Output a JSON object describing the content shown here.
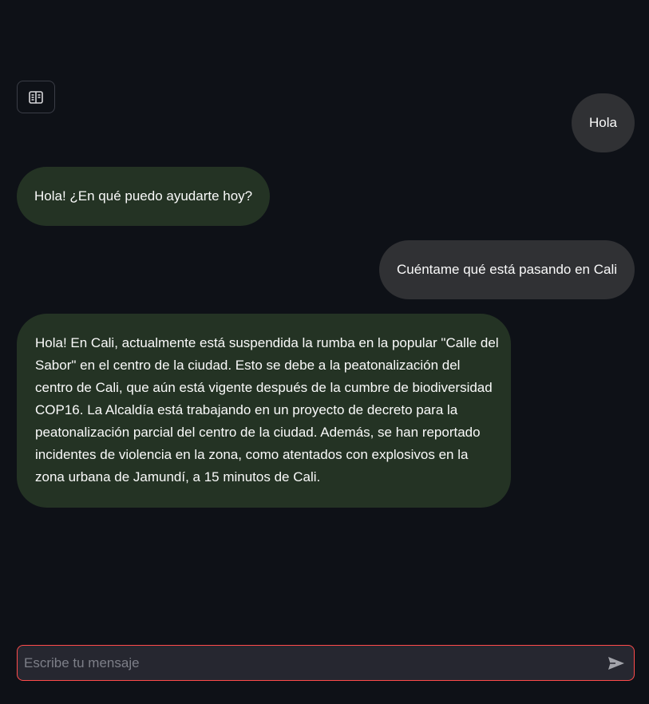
{
  "sidebar": {
    "toggle_icon": "book-open-icon"
  },
  "messages": [
    {
      "role": "user",
      "text": "Hola"
    },
    {
      "role": "assistant",
      "text": "Hola! ¿En qué puedo ayudarte hoy?"
    },
    {
      "role": "user",
      "text": "Cuéntame qué está pasando en Cali"
    },
    {
      "role": "assistant",
      "text": "Hola! En Cali, actualmente está suspendida la rumba en la popular \"Calle del Sabor\" en el centro de la ciudad. Esto se debe a la peatonalización del centro de Cali, que aún está vigente después de la cumbre de biodiversidad COP16. La Alcaldía está trabajando en un proyecto de decreto para la peatonalización parcial del centro de la ciudad. Además, se han reportado incidentes de violencia en la zona, como atentados con explosivos en la zona urbana de Jamundí, a 15 minutos de Cali."
    }
  ],
  "chat_input": {
    "placeholder": "Escribe tu mensaje",
    "value": "",
    "send_icon": "send-icon"
  },
  "colors": {
    "background": "#0e1117",
    "user_bubble": "#303134",
    "assistant_bubble": "#243324",
    "input_border_focus": "#ff4b4b"
  }
}
